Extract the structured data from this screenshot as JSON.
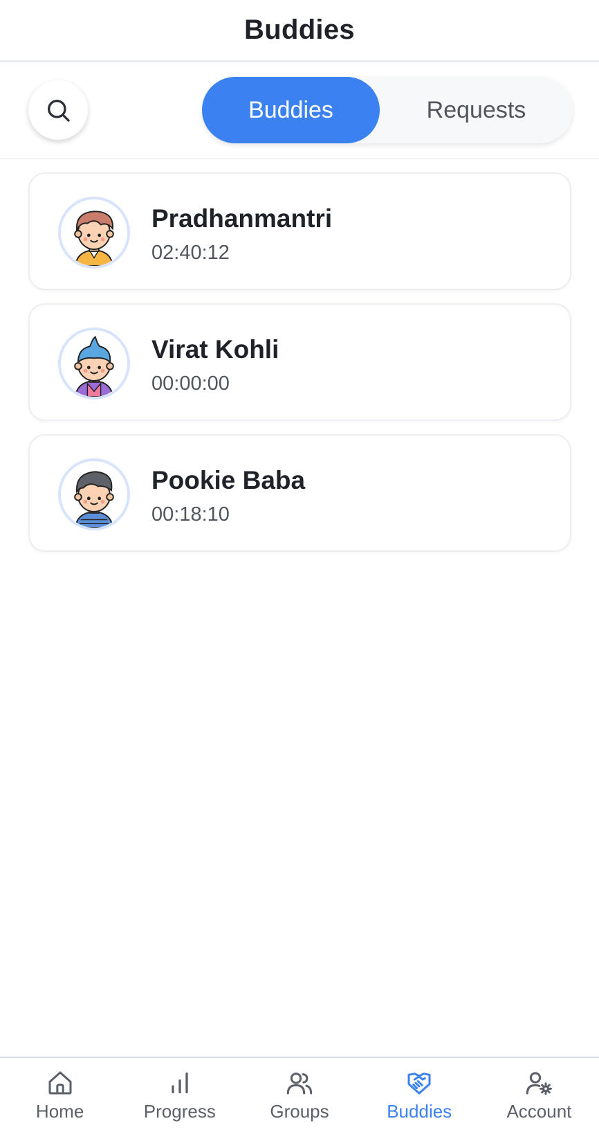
{
  "header": {
    "title": "Buddies"
  },
  "tabs": {
    "active": "Buddies",
    "inactive": "Requests"
  },
  "colors": {
    "accent": "#3b82f0",
    "text": "#1f2329",
    "muted": "#51565d"
  },
  "buddies": [
    {
      "name": "Pradhanmantri",
      "time": "02:40:12",
      "avatar": "boy-brown-hair-avatar"
    },
    {
      "name": "Virat Kohli",
      "time": "00:00:00",
      "avatar": "boy-blue-hair-avatar"
    },
    {
      "name": "Pookie Baba",
      "time": "00:18:10",
      "avatar": "boy-gray-hair-avatar"
    }
  ],
  "nav": [
    {
      "label": "Home",
      "icon": "home-icon"
    },
    {
      "label": "Progress",
      "icon": "bar-chart-icon"
    },
    {
      "label": "Groups",
      "icon": "users-icon"
    },
    {
      "label": "Buddies",
      "icon": "handshake-icon",
      "active": true
    },
    {
      "label": "Account",
      "icon": "user-settings-icon"
    }
  ]
}
